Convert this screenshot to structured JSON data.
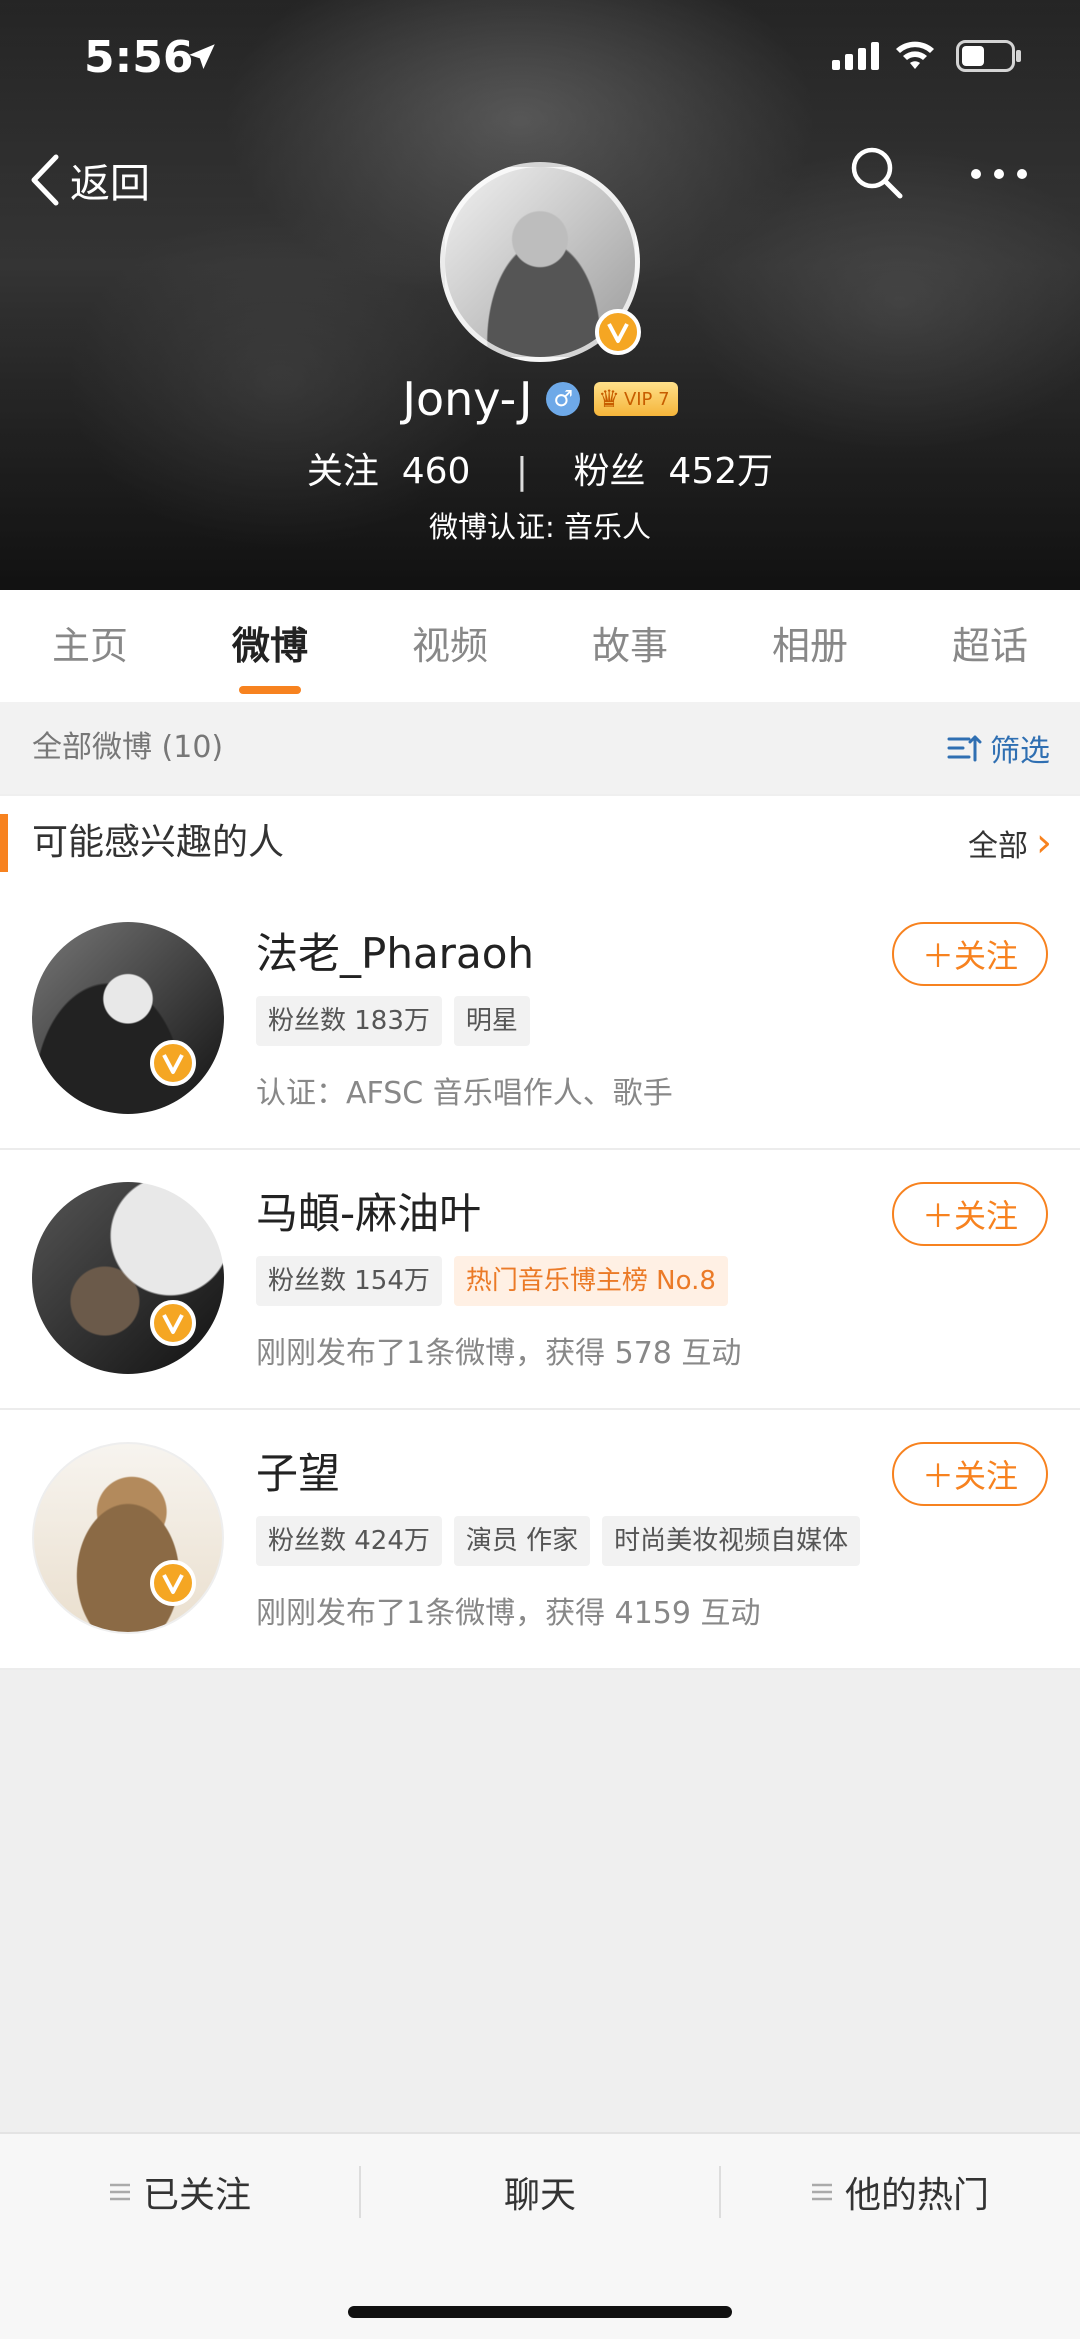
{
  "status_bar": {
    "time": "5:56"
  },
  "nav": {
    "back_label": "返回"
  },
  "profile": {
    "name": "Jony-J",
    "gender_symbol": "♂",
    "vip_label": "VIP 7",
    "following_label": "关注",
    "following_count": "460",
    "followers_label": "粉丝",
    "followers_count": "452万",
    "separator": "|",
    "verification": "微博认证: 音乐人"
  },
  "tabs": [
    {
      "label": "主页"
    },
    {
      "label": "微博",
      "active": true
    },
    {
      "label": "视频"
    },
    {
      "label": "故事"
    },
    {
      "label": "相册"
    },
    {
      "label": "超话"
    }
  ],
  "feed": {
    "all_posts_label": "全部微博 (10)",
    "filter_label": "筛选"
  },
  "suggestions": {
    "title": "可能感兴趣的人",
    "see_all_label": "全部",
    "follow_label": "＋关注",
    "people": [
      {
        "name": "法老_Pharaoh",
        "tags": [
          "粉丝数 183万",
          "明星"
        ],
        "desc": "认证：AFSC 音乐唱作人、歌手"
      },
      {
        "name": "马頔-麻油叶",
        "tags": [
          "粉丝数 154万",
          "热门音乐博主榜 No.8"
        ],
        "desc": "刚刚发布了1条微博，获得 578 互动"
      },
      {
        "name": "子望",
        "tags": [
          "粉丝数 424万",
          "演员 作家",
          "时尚美妆视频自媒体"
        ],
        "desc": "刚刚发布了1条微博，获得 4159 互动"
      }
    ]
  },
  "bottom_bar": {
    "followed_label": "已关注",
    "chat_label": "聊天",
    "hot_label": "他的热门"
  },
  "colors": {
    "accent": "#f7821f",
    "link": "#2f6fb2",
    "badge": "#f5a623"
  }
}
